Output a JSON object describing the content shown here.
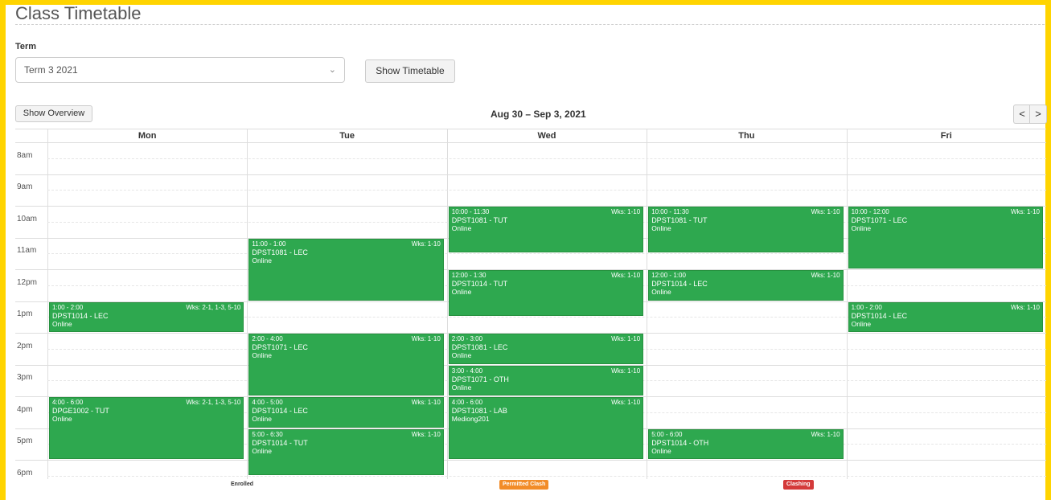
{
  "page": {
    "title": "Class Timetable"
  },
  "term": {
    "label": "Term",
    "selected": "Term 3 2021",
    "show_timetable_label": "Show Timetable"
  },
  "toolbar": {
    "show_overview_label": "Show Overview",
    "week_range": "Aug 30 – Sep 3, 2021",
    "prev_label": "<",
    "next_label": ">"
  },
  "days": [
    "Mon",
    "Tue",
    "Wed",
    "Thu",
    "Fri"
  ],
  "hours": [
    "8am",
    "9am",
    "10am",
    "11am",
    "12pm",
    "1pm",
    "2pm",
    "3pm",
    "4pm",
    "5pm",
    "6pm"
  ],
  "events": [
    {
      "day": "Mon",
      "start": 13,
      "end": 14,
      "time": "1:00 - 2:00",
      "weeks": "Wks: 2-1, 1-3, 5-10",
      "course": "DPST1014 - LEC",
      "location": "Online"
    },
    {
      "day": "Mon",
      "start": 16,
      "end": 18,
      "time": "4:00 - 6:00",
      "weeks": "Wks: 2-1, 1-3, 5-10",
      "course": "DPGE1002 - TUT",
      "location": "Online"
    },
    {
      "day": "Tue",
      "start": 11,
      "end": 13,
      "time": "11:00 - 1:00",
      "weeks": "Wks: 1-10",
      "course": "DPST1081 - LEC",
      "location": "Online"
    },
    {
      "day": "Tue",
      "start": 14,
      "end": 16,
      "time": "2:00 - 4:00",
      "weeks": "Wks: 1-10",
      "course": "DPST1071 - LEC",
      "location": "Online"
    },
    {
      "day": "Tue",
      "start": 16,
      "end": 17,
      "time": "4:00 - 5:00",
      "weeks": "Wks: 1-10",
      "course": "DPST1014 - LEC",
      "location": "Online"
    },
    {
      "day": "Tue",
      "start": 17,
      "end": 18.5,
      "time": "5:00 - 6:30",
      "weeks": "Wks: 1-10",
      "course": "DPST1014 - TUT",
      "location": "Online"
    },
    {
      "day": "Wed",
      "start": 10,
      "end": 11.5,
      "time": "10:00 - 11:30",
      "weeks": "Wks: 1-10",
      "course": "DPST1081 - TUT",
      "location": "Online"
    },
    {
      "day": "Wed",
      "start": 12,
      "end": 13.5,
      "time": "12:00 - 1:30",
      "weeks": "Wks: 1-10",
      "course": "DPST1014 - TUT",
      "location": "Online"
    },
    {
      "day": "Wed",
      "start": 14,
      "end": 15,
      "time": "2:00 - 3:00",
      "weeks": "Wks: 1-10",
      "course": "DPST1081 - LEC",
      "location": "Online"
    },
    {
      "day": "Wed",
      "start": 15,
      "end": 16,
      "time": "3:00 - 4:00",
      "weeks": "Wks: 1-10",
      "course": "DPST1071 - OTH",
      "location": "Online"
    },
    {
      "day": "Wed",
      "start": 16,
      "end": 18,
      "time": "4:00 - 6:00",
      "weeks": "Wks: 1-10",
      "course": "DPST1081 - LAB",
      "location": "Mediong201"
    },
    {
      "day": "Thu",
      "start": 10,
      "end": 11.5,
      "time": "10:00 - 11:30",
      "weeks": "Wks: 1-10",
      "course": "DPST1081 - TUT",
      "location": "Online"
    },
    {
      "day": "Thu",
      "start": 12,
      "end": 13,
      "time": "12:00 - 1:00",
      "weeks": "Wks: 1-10",
      "course": "DPST1014 - LEC",
      "location": "Online"
    },
    {
      "day": "Thu",
      "start": 17,
      "end": 18,
      "time": "5:00 - 6:00",
      "weeks": "Wks: 1-10",
      "course": "DPST1014 - OTH",
      "location": "Online"
    },
    {
      "day": "Fri",
      "start": 10,
      "end": 12,
      "time": "10:00 - 12:00",
      "weeks": "Wks: 1-10",
      "course": "DPST1071 - LEC",
      "location": "Online"
    },
    {
      "day": "Fri",
      "start": 13,
      "end": 14,
      "time": "1:00 - 2:00",
      "weeks": "Wks: 1-10",
      "course": "DPST1014 - LEC",
      "location": "Online"
    }
  ],
  "legend": {
    "enrolled": "Enrolled",
    "permitted": "Permitted Clash",
    "clashing": "Clashing"
  },
  "colors": {
    "enrolled": "#2ea84f",
    "permitted": "#f28c28",
    "clashing": "#d43a3a",
    "accent": "#ffd400"
  }
}
